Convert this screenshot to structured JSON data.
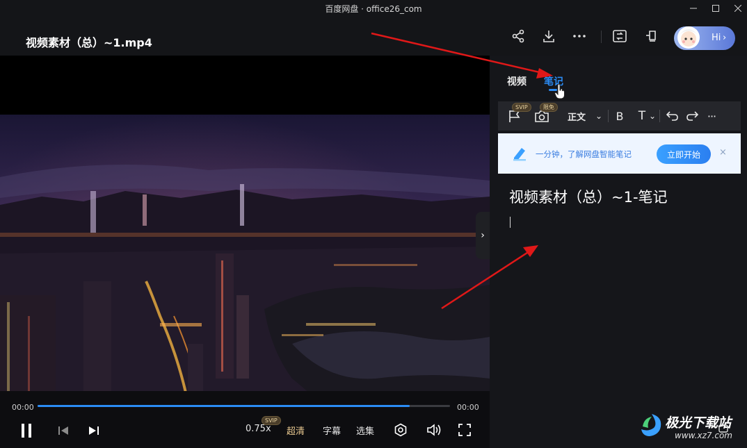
{
  "app": {
    "title": "百度网盘 · office26_com"
  },
  "header": {
    "file_name": "视频素材（总）~1.mp4",
    "hi_label": "Hi",
    "hi_chevron": "›"
  },
  "icons": {
    "share": "share-icon",
    "download": "download-icon",
    "more": "more-icon",
    "screen": "screen-switch-icon",
    "pin": "pin-icon"
  },
  "player": {
    "time_current": "00:00",
    "time_total": "00:00",
    "progress": 0.902,
    "speed": "0.75x",
    "speed_badge": "SVIP",
    "quality": "超清",
    "subtitle": "字幕",
    "episodes": "选集",
    "side_toggle": "›"
  },
  "panel": {
    "tabs": [
      {
        "label": "视频"
      },
      {
        "label": "笔记"
      }
    ],
    "active_tab": "笔记",
    "toolbar": {
      "flag_badge": "SVIP",
      "camera_badge": "限免",
      "format": "正文",
      "format_caret": "⌄",
      "bold": "B",
      "text": "T",
      "text_caret": "⌄",
      "more": "···"
    },
    "banner": {
      "text": "一分钟，了解网盘智能笔记",
      "button": "立即开始",
      "close": "×"
    },
    "note_title": "视频素材（总）~1-笔记"
  },
  "watermark": {
    "name": "极光下载站",
    "url": "www.xz7.com"
  },
  "colors": {
    "accent": "#2b8cf5",
    "annotation_arrow": "#e01818",
    "banner_bg": "#eef5ff"
  }
}
